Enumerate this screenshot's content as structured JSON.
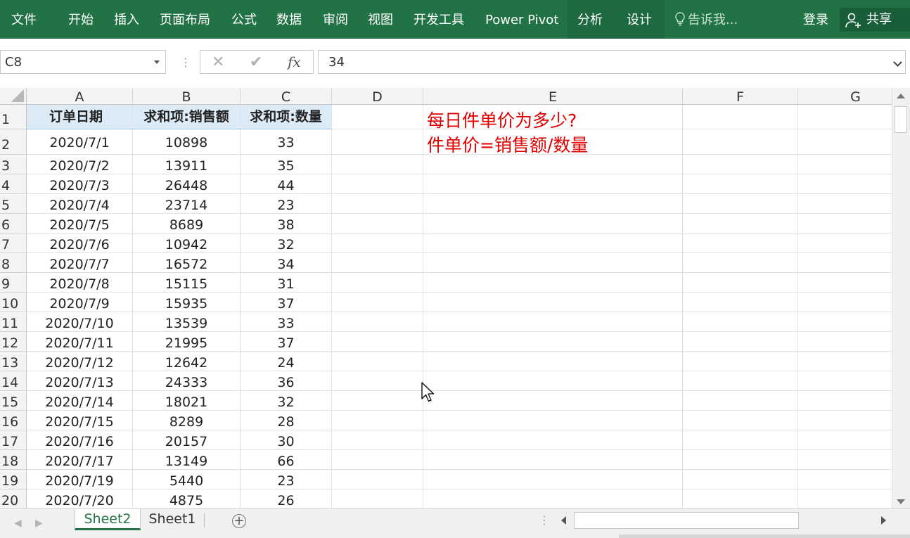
{
  "ribbon": {
    "tabs": [
      {
        "id": "file",
        "label": "文件"
      },
      {
        "id": "home",
        "label": "开始"
      },
      {
        "id": "insert",
        "label": "插入"
      },
      {
        "id": "layout",
        "label": "页面布局"
      },
      {
        "id": "formulas",
        "label": "公式"
      },
      {
        "id": "data",
        "label": "数据"
      },
      {
        "id": "review",
        "label": "审阅"
      },
      {
        "id": "view",
        "label": "视图"
      },
      {
        "id": "developer",
        "label": "开发工具"
      },
      {
        "id": "powerpivot",
        "label": "Power Pivot"
      },
      {
        "id": "analyze",
        "label": "分析"
      },
      {
        "id": "design",
        "label": "设计"
      }
    ],
    "tell_me": "告诉我...",
    "signin": "登录",
    "share": "共享",
    "colors": {
      "ribbon_bg": "#217346",
      "contextual_bg": "#1d6a40"
    }
  },
  "formula_bar": {
    "name_box": "C8",
    "formula_value": "34",
    "fx_label": "fx"
  },
  "sheet": {
    "columns": [
      "A",
      "B",
      "C",
      "D",
      "E",
      "F",
      "G"
    ],
    "header_row": {
      "A": "订单日期",
      "B": "求和项:销售额",
      "C": "求和项:数量"
    },
    "rows": [
      {
        "row": "1"
      },
      {
        "row": "2",
        "A": "2020/7/1",
        "B": "10898",
        "C": "33"
      },
      {
        "row": "3",
        "A": "2020/7/2",
        "B": "13911",
        "C": "35"
      },
      {
        "row": "4",
        "A": "2020/7/3",
        "B": "26448",
        "C": "44"
      },
      {
        "row": "5",
        "A": "2020/7/4",
        "B": "23714",
        "C": "23"
      },
      {
        "row": "6",
        "A": "2020/7/5",
        "B": "8689",
        "C": "38"
      },
      {
        "row": "7",
        "A": "2020/7/6",
        "B": "10942",
        "C": "32"
      },
      {
        "row": "8",
        "A": "2020/7/7",
        "B": "16572",
        "C": "34"
      },
      {
        "row": "9",
        "A": "2020/7/8",
        "B": "15115",
        "C": "31"
      },
      {
        "row": "10",
        "A": "2020/7/9",
        "B": "15935",
        "C": "37"
      },
      {
        "row": "11",
        "A": "2020/7/10",
        "B": "13539",
        "C": "33"
      },
      {
        "row": "12",
        "A": "2020/7/11",
        "B": "21995",
        "C": "37"
      },
      {
        "row": "13",
        "A": "2020/7/12",
        "B": "12642",
        "C": "24"
      },
      {
        "row": "14",
        "A": "2020/7/13",
        "B": "24333",
        "C": "36"
      },
      {
        "row": "15",
        "A": "2020/7/14",
        "B": "18021",
        "C": "32"
      },
      {
        "row": "16",
        "A": "2020/7/15",
        "B": "8289",
        "C": "28"
      },
      {
        "row": "17",
        "A": "2020/7/16",
        "B": "20157",
        "C": "30"
      },
      {
        "row": "18",
        "A": "2020/7/17",
        "B": "13149",
        "C": "66"
      },
      {
        "row": "19",
        "A": "2020/7/19",
        "B": "5440",
        "C": "23"
      },
      {
        "row": "20",
        "A": "2020/7/20",
        "B": "4875",
        "C": "26"
      }
    ],
    "notes": [
      "每日件单价为多少?",
      "件单价=销售额/数量"
    ],
    "note_color": "#e00000",
    "pivot_header_color": "#ddebf7"
  },
  "sheet_tabs": {
    "tabs": [
      {
        "label": "Sheet2",
        "active": true
      },
      {
        "label": "Sheet1",
        "active": false
      }
    ]
  }
}
